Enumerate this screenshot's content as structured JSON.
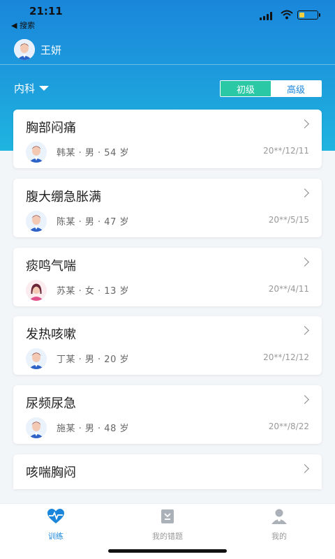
{
  "status": {
    "time": "21:11",
    "back_label": "◀ 搜索"
  },
  "user": {
    "name": "王妍"
  },
  "filter": {
    "department": "内科"
  },
  "levels": {
    "basic": "初级",
    "advanced": "高级",
    "selected": "初级"
  },
  "cases": [
    {
      "title": "胸部闷痛",
      "info": "韩某 · 男 · 54 岁",
      "date": "20**/12/11",
      "gender": "male"
    },
    {
      "title": "腹大绷急胀满",
      "info": "陈某 · 男 · 47 岁",
      "date": "20**/5/15",
      "gender": "male"
    },
    {
      "title": "痰鸣气喘",
      "info": "苏某 · 女 · 13 岁",
      "date": "20**/4/11",
      "gender": "female"
    },
    {
      "title": "发热咳嗽",
      "info": "丁某 · 男 · 20 岁",
      "date": "20**/12/12",
      "gender": "male"
    },
    {
      "title": "尿频尿急",
      "info": "施某 · 男 · 48 岁",
      "date": "20**/8/22",
      "gender": "male"
    },
    {
      "title": "咳喘胸闷",
      "info": "",
      "date": "",
      "gender": "male"
    }
  ],
  "tabs": [
    {
      "label": "训练",
      "icon": "heartbeat-icon",
      "active": true
    },
    {
      "label": "我的错题",
      "icon": "notebook-icon",
      "active": false
    },
    {
      "label": "我的",
      "icon": "person-icon",
      "active": false
    }
  ],
  "colors": {
    "accent": "#1a86db",
    "active_level": "#2bc8a6",
    "tab_active": "#1a86db",
    "tab_inactive": "#999999"
  }
}
